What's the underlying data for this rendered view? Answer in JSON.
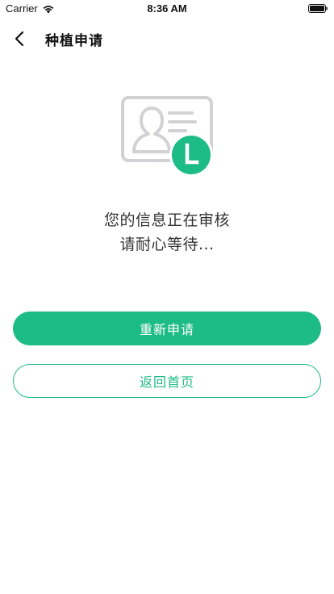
{
  "status_bar": {
    "carrier": "Carrier",
    "time": "8:36 AM",
    "wifi_icon": "wifi-icon",
    "battery_icon": "battery-icon"
  },
  "nav": {
    "back_icon": "chevron-left-icon",
    "title": "种植申请"
  },
  "illustration": {
    "icon": "id-card-pending-icon",
    "badge_icon": "clock-icon"
  },
  "message": {
    "line1": "您的信息正在审核",
    "line2": "请耐心等待..."
  },
  "actions": {
    "reapply_label": "重新申请",
    "home_label": "返回首页"
  },
  "colors": {
    "accent": "#1dbb85",
    "card_gray": "#d2d2d6"
  }
}
